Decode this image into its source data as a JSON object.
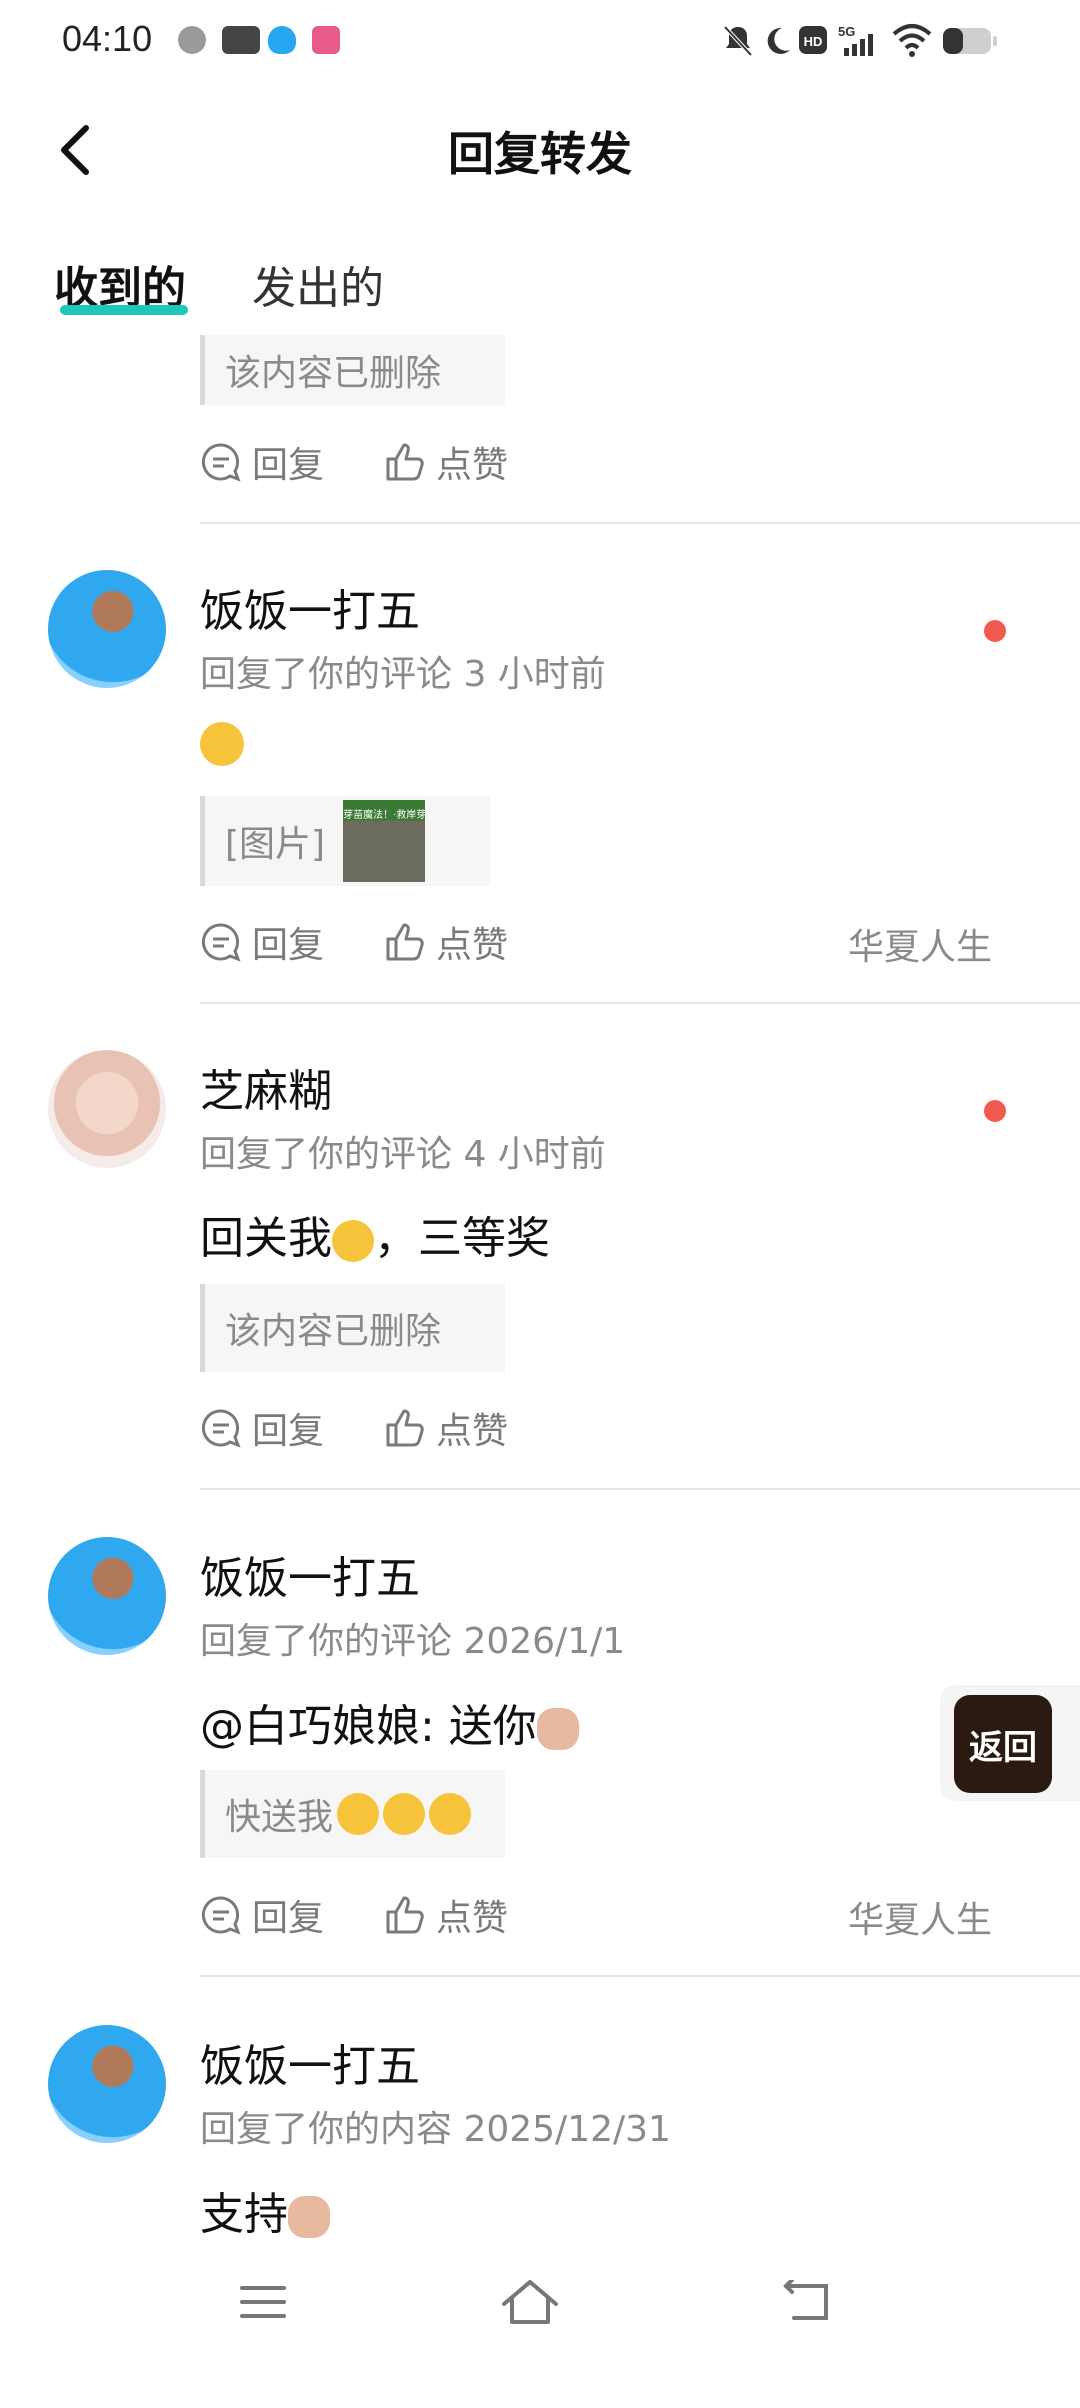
{
  "status": {
    "time": "04:10"
  },
  "header": {
    "title": "回复转发"
  },
  "tabs": [
    {
      "label": "收到的"
    },
    {
      "label": "发出的"
    }
  ],
  "actions": {
    "reply": "回复",
    "like": "点赞"
  },
  "items": [
    {
      "quote": "该内容已删除"
    },
    {
      "name": "饭饭一打五",
      "meta": "回复了你的评论 3 小时前",
      "quote_text": "[图片]",
      "image_caption": "芽苗魔法！·救岸芽苗",
      "tag": "华夏人生"
    },
    {
      "name": "芝麻糊",
      "meta": "回复了你的评论 4 小时前",
      "content_a": "回关我",
      "content_b": "，三等奖",
      "quote": "该内容已删除"
    },
    {
      "name": "饭饭一打五",
      "meta": "回复了你的评论 2026/1/1",
      "content": "@白巧娘娘: 送你",
      "quote": "快送我",
      "tag": "华夏人生"
    },
    {
      "name": "饭饭一打五",
      "meta": "回复了你的内容 2025/12/31",
      "content": "支持"
    }
  ],
  "floating": {
    "label": "返回"
  }
}
